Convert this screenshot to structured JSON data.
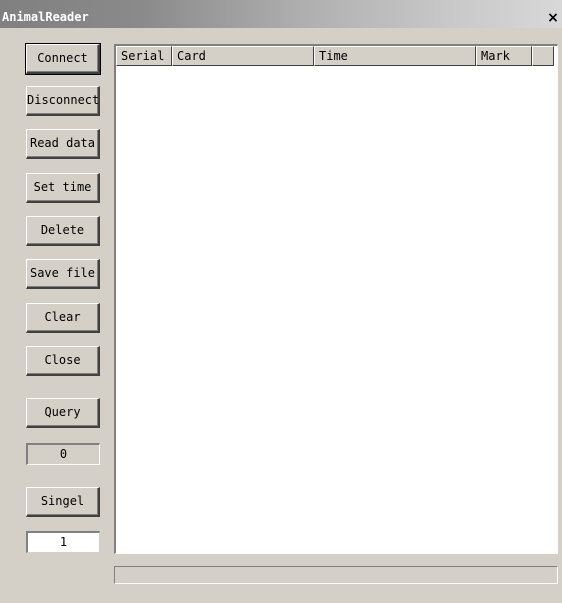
{
  "window": {
    "title": "AnimalReader",
    "close_glyph": "×"
  },
  "buttons": {
    "connect": "Connect",
    "disconnect": "Disconnect",
    "read_data": "Read data",
    "set_time": "Set time",
    "delete": "Delete",
    "save_file": "Save file",
    "clear": "Clear",
    "close": "Close",
    "query": "Query",
    "single": "Singel"
  },
  "counters": {
    "query_count": "0",
    "single_value": "1"
  },
  "table": {
    "columns": [
      "Serial",
      "Card",
      "Time",
      "Mark",
      ""
    ],
    "rows": []
  },
  "progress": {
    "value": 0
  },
  "colors": {
    "face": "#d4d0c8",
    "list_bg": "#ffffff",
    "title_gradient_start": "#808080",
    "title_gradient_end": "#d8d8d8"
  }
}
